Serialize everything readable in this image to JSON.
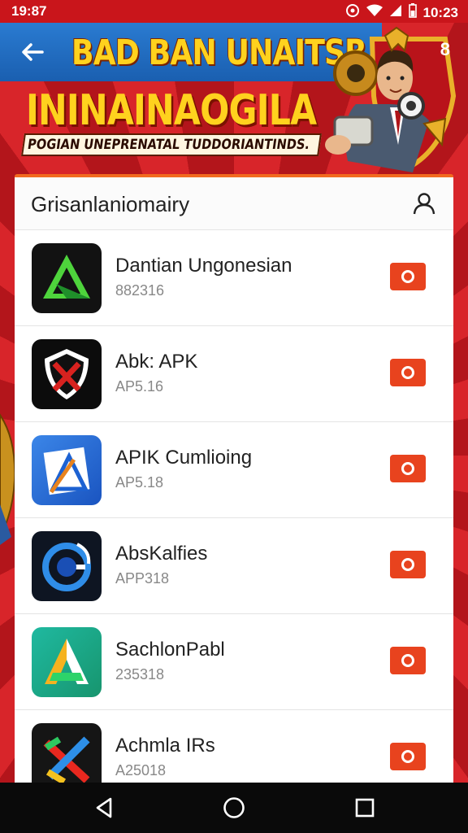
{
  "status_bar": {
    "time": "19:87",
    "right_time": "10:23"
  },
  "banner": {
    "title": "BAD BAN UNAITSR",
    "subtitle": "ININAINAOGILA",
    "tagline": "POGIAN UNEPRENATAL TUDDORIANTINDS.",
    "menu_number": "8"
  },
  "card": {
    "title": "Grisanlaniomairy"
  },
  "apps": [
    {
      "name": "Dantian Ungonesian",
      "meta": "882316",
      "icon": "green-triangle-a-icon"
    },
    {
      "name": "Abk: APK",
      "meta": "AP5.16",
      "icon": "shield-x-icon"
    },
    {
      "name": "APIK Cumlioing",
      "meta": "AP5.18",
      "icon": "blue-triangle-document-icon"
    },
    {
      "name": "AbsKalfies",
      "meta": "APP318",
      "icon": "blue-swirl-icon"
    },
    {
      "name": "SachlonPabl",
      "meta": "235318",
      "icon": "multicolor-a-icon"
    },
    {
      "name": "Achmla IRs",
      "meta": "A25018",
      "icon": "multicolor-x-icon"
    }
  ],
  "colors": {
    "accent": "#e8431e",
    "banner_blue": "#1f6cc4",
    "banner_yellow": "#ffd21e",
    "background_red": "#c9151b"
  }
}
